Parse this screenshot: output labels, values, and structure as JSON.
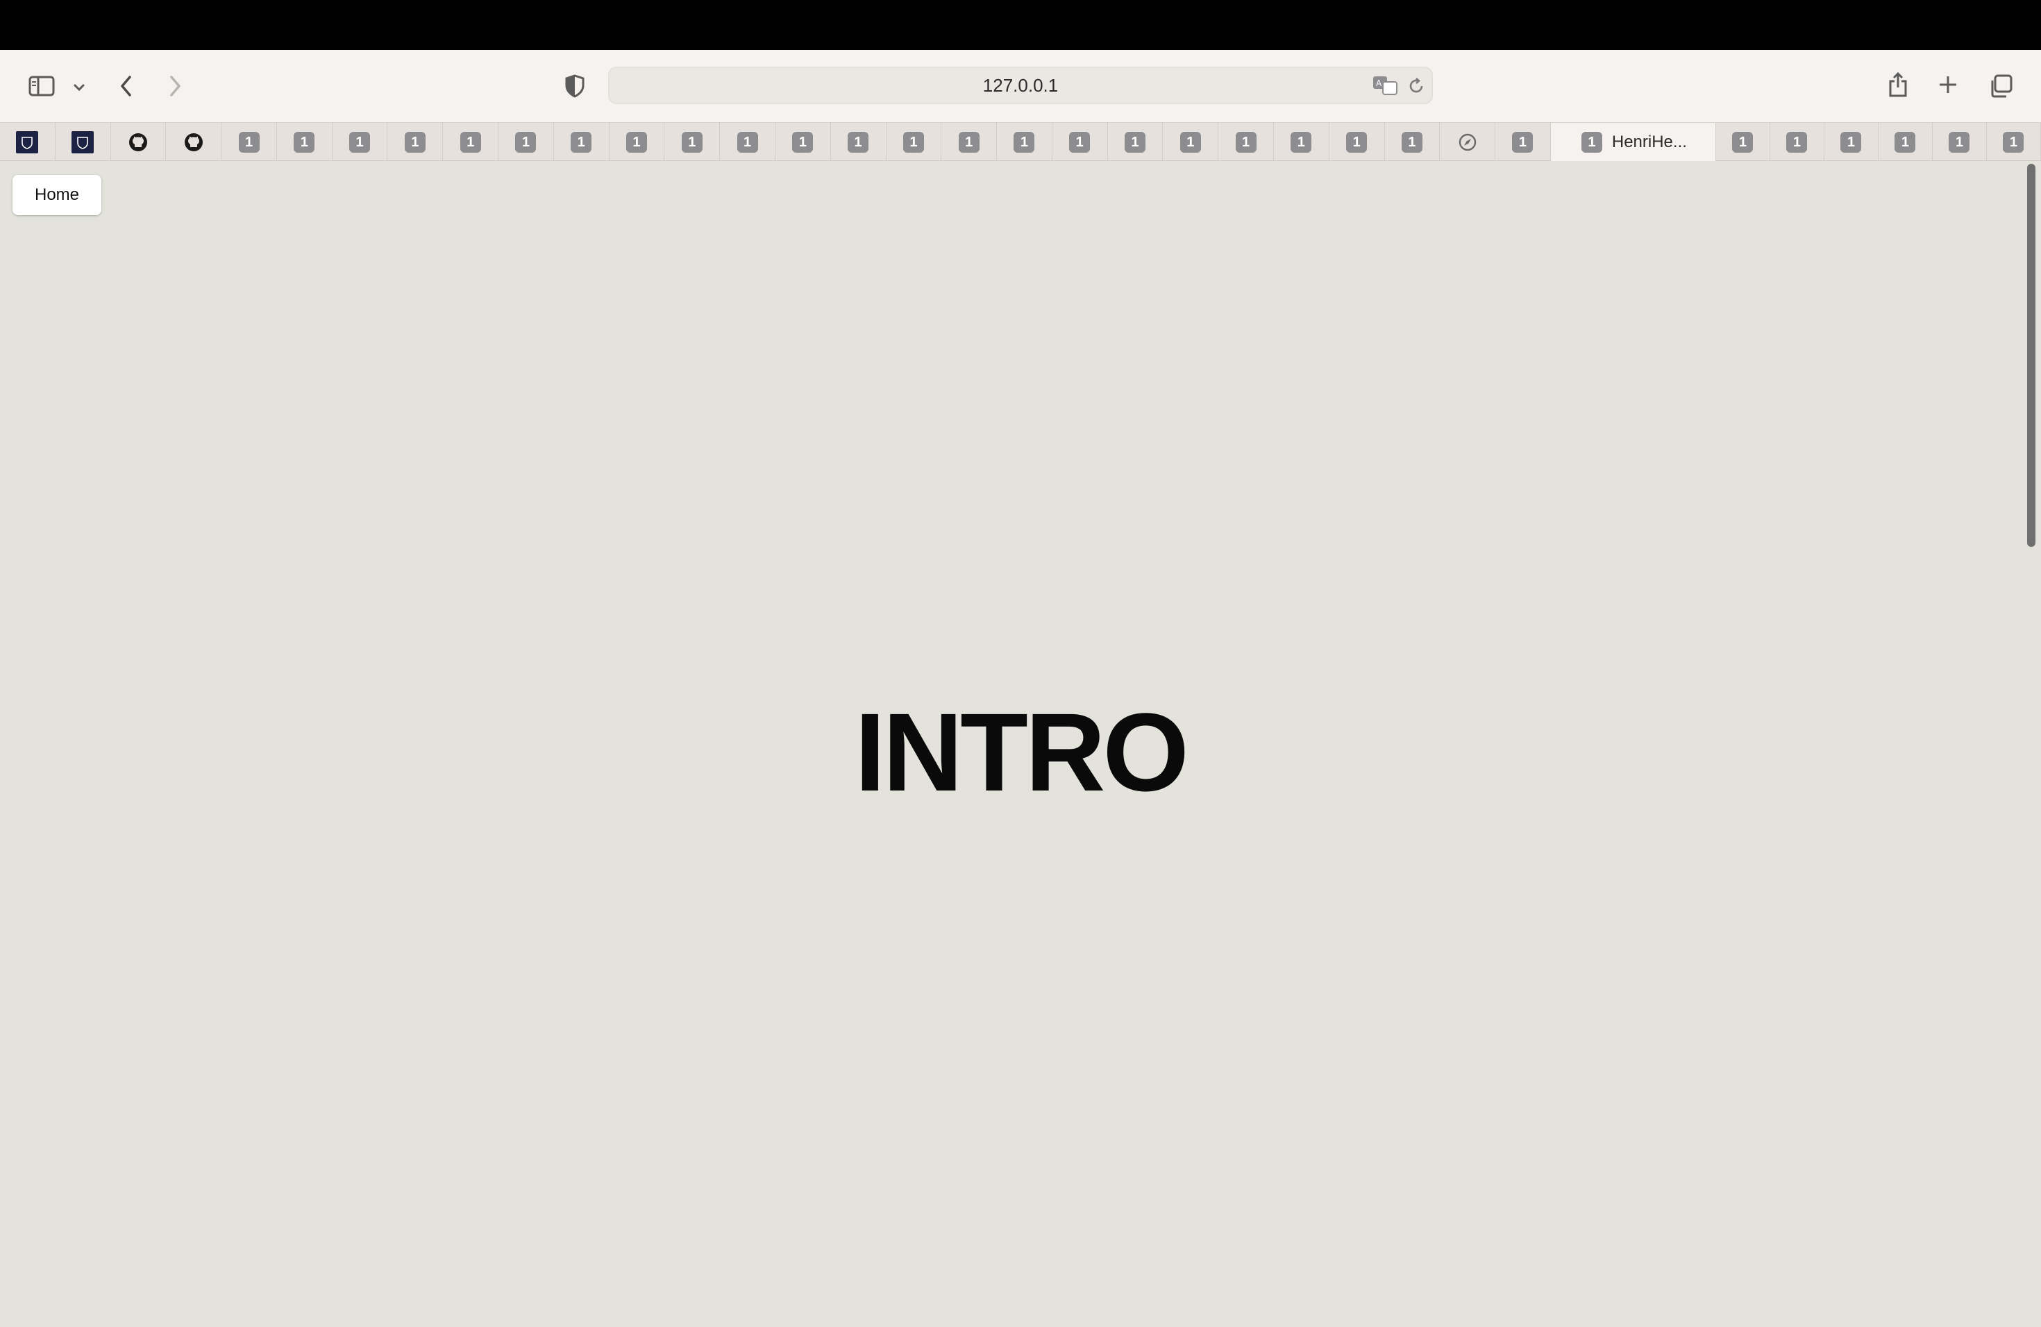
{
  "browser": {
    "url": "127.0.0.1",
    "active_tab_title": "HenriHe...",
    "tab_badge_text": "1",
    "tabs_before_active": [
      {
        "kind": "logo",
        "icon": "university-crest-icon"
      },
      {
        "kind": "logo",
        "icon": "university-crest-icon"
      },
      {
        "kind": "github",
        "icon": "github-icon"
      },
      {
        "kind": "github",
        "icon": "github-icon"
      },
      {
        "kind": "badge"
      },
      {
        "kind": "badge"
      },
      {
        "kind": "badge"
      },
      {
        "kind": "badge"
      },
      {
        "kind": "badge"
      },
      {
        "kind": "badge"
      },
      {
        "kind": "badge"
      },
      {
        "kind": "badge"
      },
      {
        "kind": "badge"
      },
      {
        "kind": "badge"
      },
      {
        "kind": "badge"
      },
      {
        "kind": "badge"
      },
      {
        "kind": "badge"
      },
      {
        "kind": "badge"
      },
      {
        "kind": "badge"
      },
      {
        "kind": "badge"
      },
      {
        "kind": "badge"
      },
      {
        "kind": "badge"
      },
      {
        "kind": "badge"
      },
      {
        "kind": "badge"
      },
      {
        "kind": "badge"
      },
      {
        "kind": "badge"
      },
      {
        "kind": "compass",
        "icon": "compass-icon"
      },
      {
        "kind": "badge"
      }
    ],
    "tabs_after_active": [
      {
        "kind": "badge"
      },
      {
        "kind": "badge"
      },
      {
        "kind": "badge"
      },
      {
        "kind": "badge"
      },
      {
        "kind": "badge"
      },
      {
        "kind": "badge"
      }
    ]
  },
  "page": {
    "home_button_label": "Home",
    "heading": "INTRO"
  },
  "colors": {
    "page_background": "#e3e3dc",
    "toolbar_background": "#f6f2ef",
    "badge": "#8d8d90",
    "heading": "#0a0a0a"
  }
}
